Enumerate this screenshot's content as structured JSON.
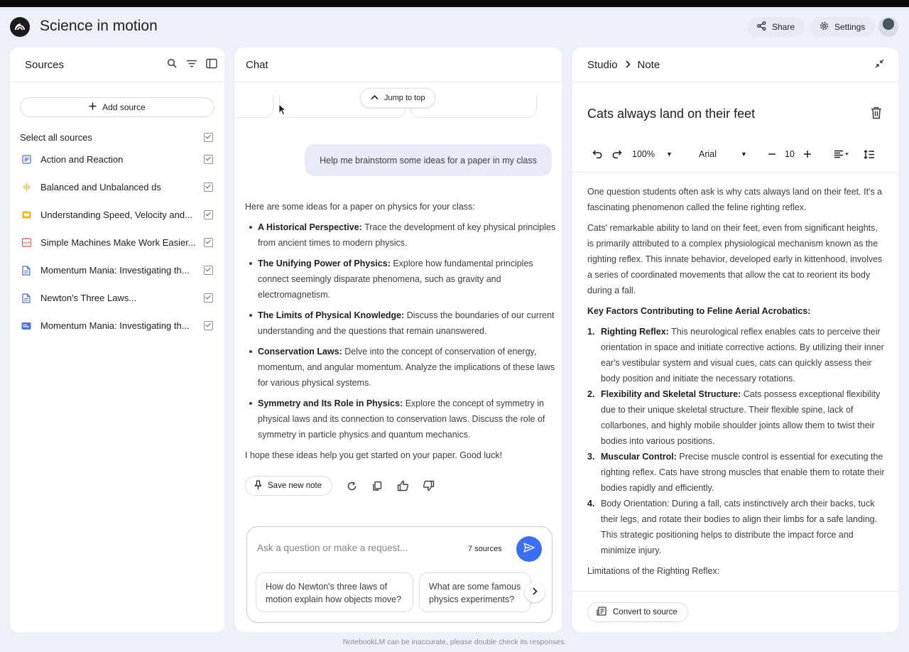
{
  "app": {
    "title": "Science in motion"
  },
  "header": {
    "share_label": "Share",
    "settings_label": "Settings"
  },
  "sources": {
    "title": "Sources",
    "add_source_label": "Add source",
    "select_all_label": "Select all sources",
    "items": [
      {
        "label": "Action and Reaction",
        "icon": "doc-icon",
        "color": "#4a76d6"
      },
      {
        "label": "Balanced and Unbalanced ds",
        "icon": "audio-icon",
        "color": "#f3b43a"
      },
      {
        "label": "Understanding Speed, Velocity and...",
        "icon": "slides-icon",
        "color": "#f2b51d"
      },
      {
        "label": "Simple Machines Make Work Easier...",
        "icon": "pdf-icon",
        "color": "#d35a4a"
      },
      {
        "label": "Momentum Mania: Investigating th...",
        "icon": "file-icon",
        "color": "#4a76d6"
      },
      {
        "label": "Newton's Three Laws...",
        "icon": "file-icon",
        "color": "#4a76d6"
      },
      {
        "label": "Momentum Mania: Investigating th...",
        "icon": "web-icon",
        "color": "#4a76d6"
      }
    ]
  },
  "chat": {
    "title": "Chat",
    "jump_label": "Jump to top",
    "user_message": "Help me brainstorm some ideas for a paper in my class",
    "response_intro": "Here are some ideas for a paper on physics for your class:",
    "response_items": [
      {
        "bold": "A Historical Perspective:",
        "text": " Trace the development of key physical principles from ancient times to modern physics."
      },
      {
        "bold": "The Unifying Power of Physics:",
        "text": " Explore how fundamental principles connect seemingly disparate phenomena, such as gravity and electromagnetism."
      },
      {
        "bold": "The Limits of Physical Knowledge:",
        "text": " Discuss the boundaries of our current understanding and the questions that remain unanswered."
      },
      {
        "bold": "Conservation Laws:",
        "text": " Delve into the concept of conservation of energy, momentum, and angular momentum. Analyze the implications of these laws for various physical systems."
      },
      {
        "bold": "Symmetry and Its Role in Physics:",
        "text": " Explore the concept of symmetry in physical laws and its connection to conservation laws. Discuss the role of symmetry in particle physics and quantum mechanics."
      }
    ],
    "response_outro": "I hope these ideas help you get started on your paper. Good luck!",
    "save_note_label": "Save new note",
    "input_placeholder": "Ask a question or make a request...",
    "source_count": "7 sources",
    "suggestions": [
      "How do Newton's three laws of motion explain how objects move?",
      "What are some famous physics experiments?"
    ]
  },
  "studio": {
    "crumb_root": "Studio",
    "crumb_leaf": "Note",
    "note_title": "Cats always land on their feet",
    "toolbar": {
      "zoom": "100%",
      "font": "Arial",
      "font_size": "10"
    },
    "paragraphs": [
      "One question students often ask is why cats always land on their feet. It's a fascinating phenomenon called the feline righting reflex.",
      "Cats' remarkable ability to land on their feet, even from significant heights, is primarily attributed to a complex physiological mechanism known as the righting reflex. This innate behavior, developed early in kittenhood, involves a series of coordinated movements that allow the cat to reorient its body during a fall."
    ],
    "key_heading": "Key Factors Contributing to Feline Aerial Acrobatics:",
    "factors": [
      {
        "num": "1.",
        "bold": "Righting Reflex:",
        "text": " This neurological reflex enables cats to perceive their orientation in space and initiate corrective actions. By utilizing their inner ear's vestibular system and visual cues, cats can quickly assess their body position and initiate the necessary rotations."
      },
      {
        "num": "2.",
        "bold": "Flexibility and Skeletal Structure:",
        "text": " Cats possess exceptional flexibility due to their unique skeletal structure. Their flexible spine, lack of collarbones, and highly mobile shoulder joints allow them to twist their bodies into various positions."
      },
      {
        "num": "3.",
        "bold": "Muscular Control:",
        "text": " Precise muscle control is essential for executing the righting reflex. Cats have strong muscles that enable them to rotate their bodies rapidly and efficiently."
      },
      {
        "num": "4.",
        "bold": "",
        "text": "Body Orientation: During a fall, cats instinctively arch their backs, tuck their legs, and rotate their bodies to align their limbs for a safe landing. This strategic positioning helps to distribute the impact force and minimize injury."
      }
    ],
    "limitations": "Limitations of the Righting Reflex:",
    "convert_label": "Convert to source"
  },
  "footer": {
    "disclaimer": "NotebookLM can be inaccurate, please double check its responses."
  },
  "colors": {
    "accent": "#3b6ff2",
    "background": "#eef0f8",
    "bubble": "#e8ebf7"
  }
}
